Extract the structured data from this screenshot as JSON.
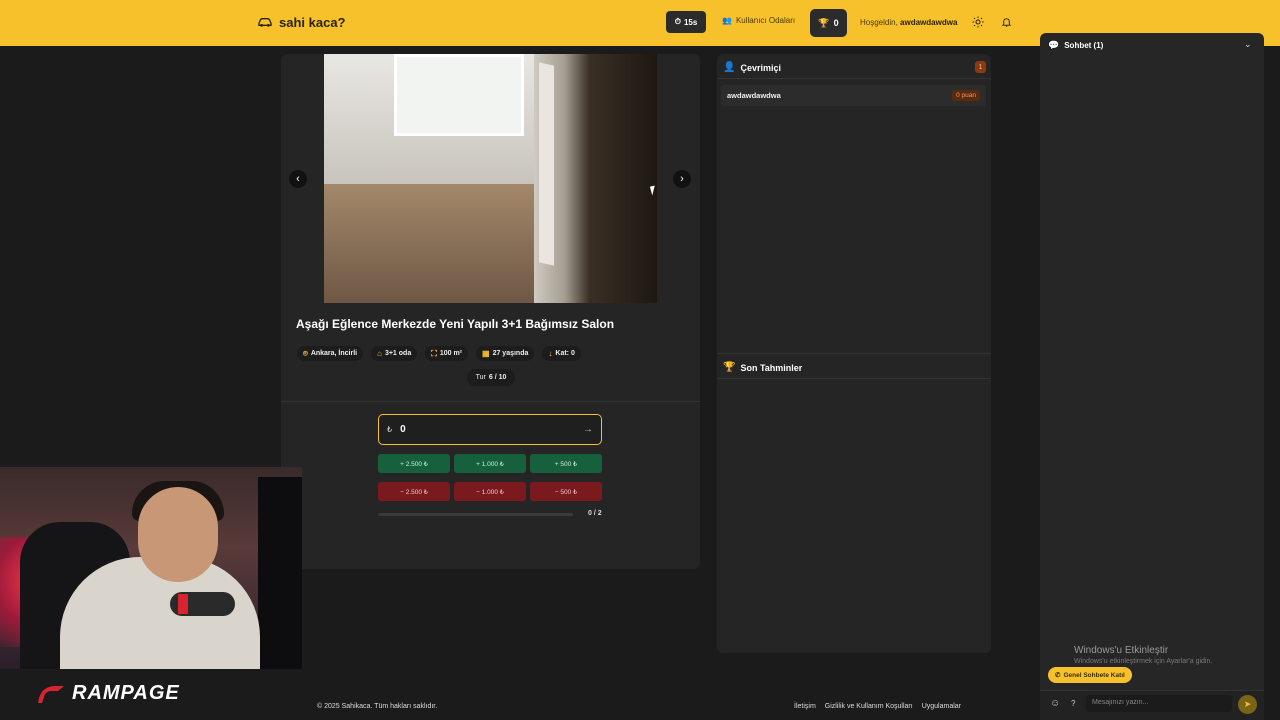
{
  "header": {
    "brand": "sahi kaca?",
    "timer": "15s",
    "rooms_label": "Kullanıcı Odaları",
    "score": "0",
    "welcome_prefix": "Hoşgeldin,",
    "username": "awdawdawdwa"
  },
  "listing": {
    "title": "Aşağı Eğlence Merkezde Yeni Yapılı 3+1 Bağımsız Salon",
    "chips": [
      "Ankara, İncirli",
      "3+1 oda",
      "100 m²",
      "27 yaşında",
      "Kat: 0"
    ],
    "round_label": "Tur",
    "round_value": "6 / 10"
  },
  "guess": {
    "currency": "₺",
    "value": "0",
    "plus_buttons": [
      "+ 2.500 ₺",
      "+ 1.000 ₺",
      "+ 500 ₺"
    ],
    "minus_buttons": [
      "− 2.500 ₺",
      "− 1.000 ₺",
      "− 500 ₺"
    ],
    "progress_text": "0 / 2",
    "progress_fraction": 0
  },
  "online": {
    "title": "Çevrimiçi",
    "count": "1",
    "users": [
      {
        "name": "awdawdawdwa",
        "points": "0 puan"
      }
    ]
  },
  "recent": {
    "title": "Son Tahminler"
  },
  "chat": {
    "title": "Sohbet (1)",
    "join_label": "Genel Sohbete Katıl",
    "placeholder": "Mesajınızı yazın...",
    "question": "?"
  },
  "windows_activation": {
    "line1": "Windows'u Etkinleştir",
    "line2": "Windows'u etkinleştirmek için Ayarlar'a gidin."
  },
  "footer": {
    "copyright": "© 2025 Sahikaca. Tüm hakları saklıdır.",
    "links": [
      "İletişim",
      "Gizlilik ve Kullanım Koşulları",
      "Uygulamalar"
    ]
  },
  "overlay": {
    "brand": "RAMPAGE"
  },
  "colors": {
    "accent": "#f6c12b",
    "background": "#1b1b1b",
    "panel": "#252525",
    "plus": "#17603d",
    "minus": "#7a1a1f"
  }
}
